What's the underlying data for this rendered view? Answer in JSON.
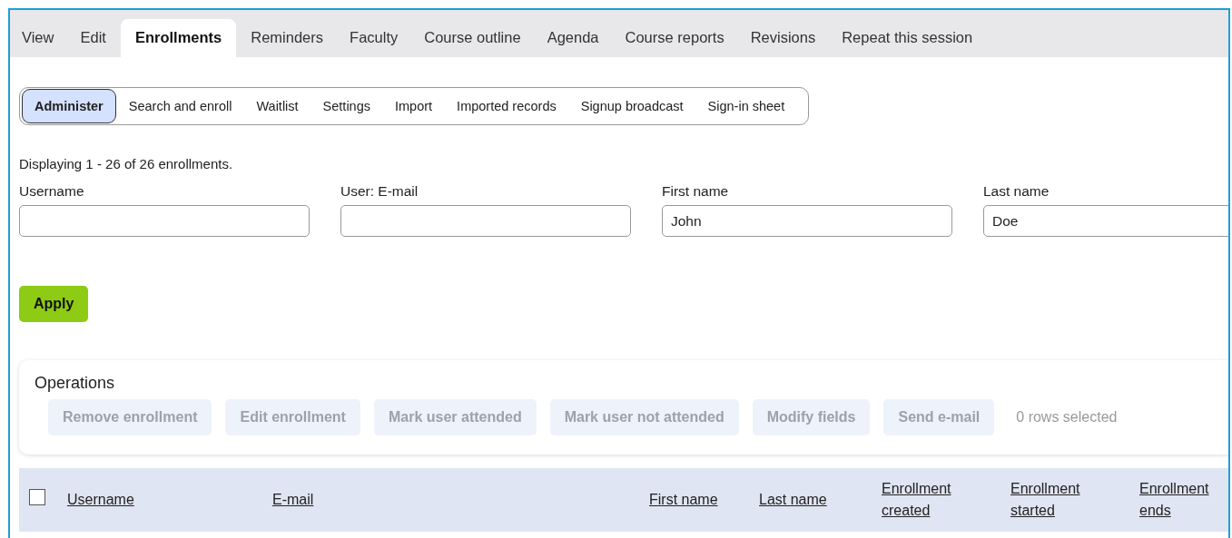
{
  "tabs": [
    {
      "label": "View",
      "selected": false
    },
    {
      "label": "Edit",
      "selected": false
    },
    {
      "label": "Enrollments",
      "selected": true
    },
    {
      "label": "Reminders",
      "selected": false
    },
    {
      "label": "Faculty",
      "selected": false
    },
    {
      "label": "Course outline",
      "selected": false
    },
    {
      "label": "Agenda",
      "selected": false
    },
    {
      "label": "Course reports",
      "selected": false
    },
    {
      "label": "Revisions",
      "selected": false
    },
    {
      "label": "Repeat this session",
      "selected": false
    }
  ],
  "subtabs": [
    {
      "label": "Administer",
      "selected": true
    },
    {
      "label": "Search and enroll",
      "selected": false
    },
    {
      "label": "Waitlist",
      "selected": false
    },
    {
      "label": "Settings",
      "selected": false
    },
    {
      "label": "Import",
      "selected": false
    },
    {
      "label": "Imported records",
      "selected": false
    },
    {
      "label": "Signup broadcast",
      "selected": false
    },
    {
      "label": "Sign-in sheet",
      "selected": false
    }
  ],
  "summary": "Displaying 1 - 26 of 26 enrollments.",
  "filters": [
    {
      "label": "Username"
    },
    {
      "label": "User: E-mail"
    },
    {
      "label": "First name",
      "value": "John"
    },
    {
      "label": "Last name",
      "value": "Doe"
    }
  ],
  "apply_button": "Apply",
  "operations": {
    "title": "Operations",
    "buttons": [
      {
        "label": "Remove enrollment",
        "disabled": true
      },
      {
        "label": "Edit enrollment",
        "disabled": true
      },
      {
        "label": "Mark user attended",
        "disabled": true
      },
      {
        "label": "Mark user not attended",
        "disabled": true
      },
      {
        "label": "Modify fields",
        "disabled": true
      },
      {
        "label": "Send e-mail",
        "disabled": true
      }
    ],
    "selection_text": "0 rows selected"
  },
  "table": {
    "select_all": {
      "checked": false
    },
    "columns": [
      "Username",
      "E-mail",
      "First name",
      "Last name",
      "Enrollment created",
      "Enrollment started",
      "Enrollment ends"
    ]
  }
}
